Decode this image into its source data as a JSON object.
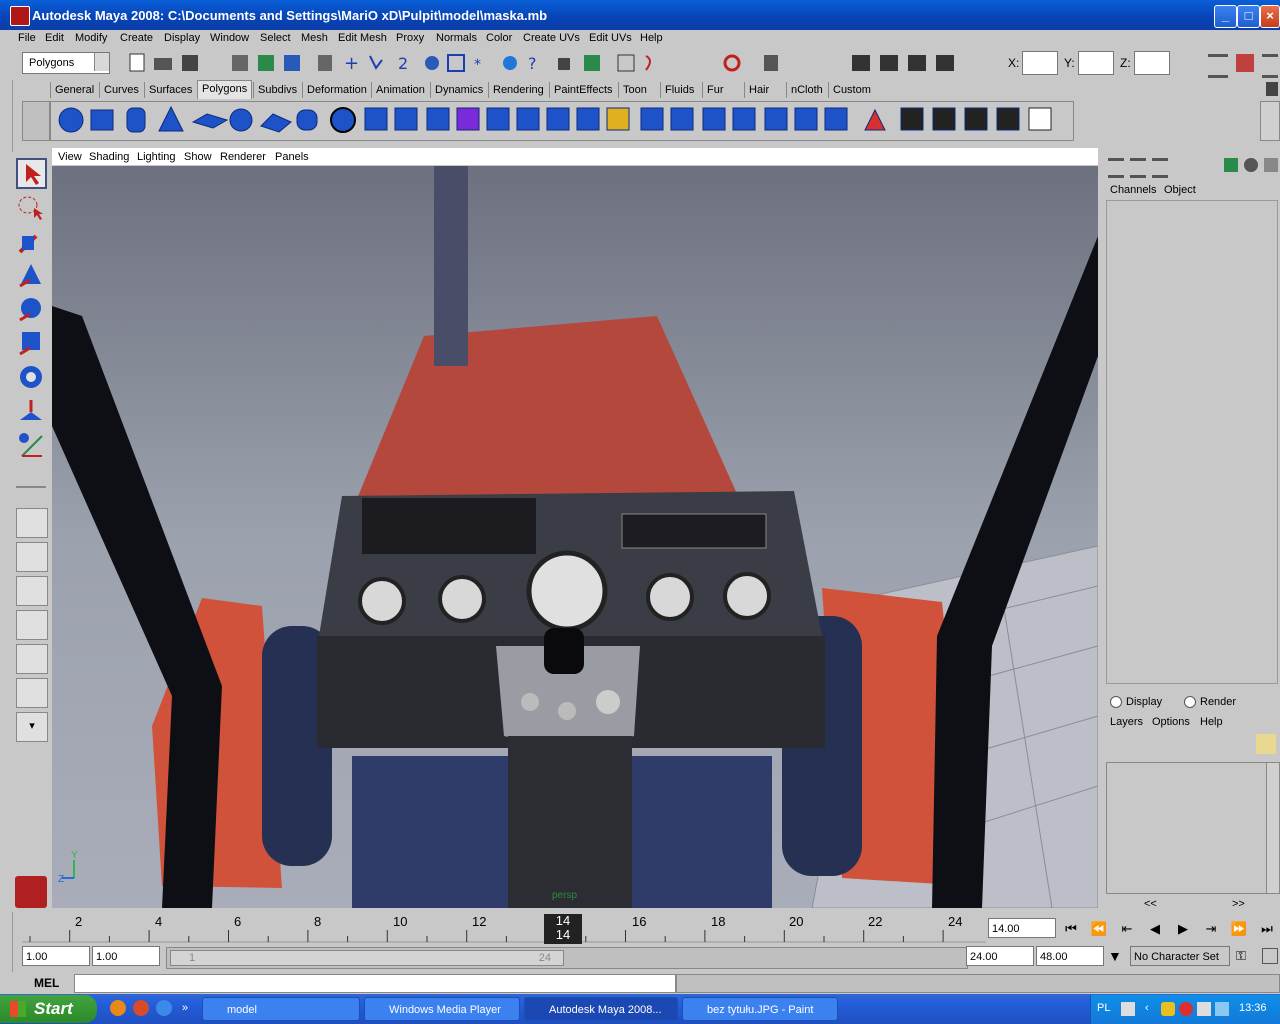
{
  "window": {
    "title": "Autodesk Maya 2008: C:\\Documents and Settings\\MariO xD\\Pulpit\\model\\maska.mb",
    "minimize": "_",
    "maximize": "□",
    "close": "×"
  },
  "menubar": [
    "File",
    "Edit",
    "Modify",
    "Create",
    "Display",
    "Window",
    "Select",
    "Mesh",
    "Edit Mesh",
    "Proxy",
    "Normals",
    "Color",
    "Create UVs",
    "Edit UVs",
    "Help"
  ],
  "statusline": {
    "mode": "Polygons",
    "x_label": "X:",
    "y_label": "Y:",
    "z_label": "Z:"
  },
  "shelf_tabs": [
    "General",
    "Curves",
    "Surfaces",
    "Polygons",
    "Subdivs",
    "Deformation",
    "Animation",
    "Dynamics",
    "Rendering",
    "PaintEffects",
    "Toon",
    "Fluids",
    "Fur",
    "Hair",
    "nCloth",
    "Custom"
  ],
  "shelf_active": "Polygons",
  "panel_menu": [
    "View",
    "Shading",
    "Lighting",
    "Show",
    "Renderer",
    "Panels"
  ],
  "viewport": {
    "camera_label": "persp",
    "axis_y": "Y",
    "axis_z": "Z"
  },
  "channel_box": {
    "tabs": [
      "Channels",
      "Object"
    ]
  },
  "layer_editor": {
    "display": "Display",
    "render": "Render",
    "menus": [
      "Layers",
      "Options",
      "Help"
    ],
    "scroll_left": "<<",
    "scroll_right": ">>"
  },
  "timeline": {
    "ticks": [
      "2",
      "4",
      "6",
      "8",
      "10",
      "12",
      "14",
      "16",
      "18",
      "20",
      "22",
      "24"
    ],
    "current_frame": "14",
    "current_field": "14.00"
  },
  "range": {
    "start": "1.00",
    "start_inner": "1.00",
    "slider_start": "1",
    "slider_end": "24",
    "end_inner": "24.00",
    "end": "48.00",
    "character_set": "No Character Set"
  },
  "command_line": {
    "label": "MEL"
  },
  "taskbar": {
    "start": "Start",
    "tasks": [
      "model",
      "Windows Media Player",
      "Autodesk Maya 2008...",
      "bez tytułu.JPG - Paint"
    ],
    "active_task": "Autodesk Maya 2008...",
    "language": "PL",
    "clock": "13:36"
  },
  "colors": {
    "title_blue": "#0843b5",
    "maya_bg": "#c8c8c8",
    "viewport_top": "#6d717f",
    "viewport_bottom": "#a9adb9",
    "tractor_red": "#c8503a",
    "taskbar_blue": "#245edb"
  }
}
